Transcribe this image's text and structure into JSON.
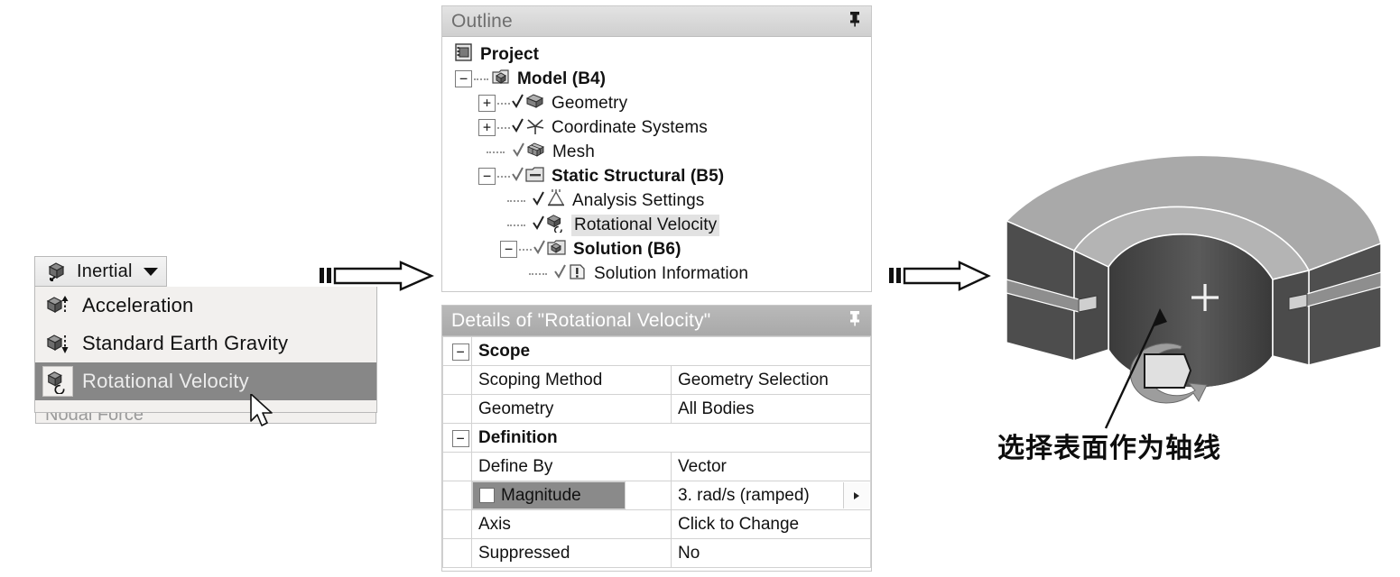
{
  "toolbar": {
    "inertial_button_label": "Inertial",
    "inertial_icon": "inertial-cube-icon",
    "caret_icon": "chevron-down-icon"
  },
  "inertial_menu": {
    "items": [
      {
        "label": "Acceleration",
        "icon": "acceleration-cube-icon",
        "selected": false
      },
      {
        "label": "Standard Earth Gravity",
        "icon": "gravity-cube-icon",
        "selected": false
      },
      {
        "label": "Rotational Velocity",
        "icon": "rotational-velocity-cube-icon",
        "selected": true
      }
    ],
    "partial_item_label": "Nodal Force"
  },
  "outline": {
    "title": "Outline",
    "pin_icon": "pin-icon",
    "tree": [
      {
        "label": "Project",
        "depth": 0,
        "bold": true,
        "expander": "",
        "icon": "project-icon",
        "highlighted": false
      },
      {
        "label": "Model (B4)",
        "depth": 1,
        "bold": true,
        "expander": "minus",
        "icon": "model-cube-icon",
        "highlighted": false
      },
      {
        "label": "Geometry",
        "depth": 2,
        "bold": false,
        "expander": "plus",
        "icon": "geometry-icon",
        "highlighted": false
      },
      {
        "label": "Coordinate Systems",
        "depth": 2,
        "bold": false,
        "expander": "plus",
        "icon": "coordinate-systems-icon",
        "highlighted": false
      },
      {
        "label": "Mesh",
        "depth": 2,
        "bold": false,
        "expander": "",
        "icon": "mesh-icon",
        "highlighted": false
      },
      {
        "label": "Static Structural (B5)",
        "depth": 2,
        "bold": true,
        "expander": "minus",
        "icon": "static-structural-icon",
        "highlighted": false
      },
      {
        "label": "Analysis Settings",
        "depth": 3,
        "bold": false,
        "expander": "",
        "icon": "analysis-settings-icon",
        "highlighted": false
      },
      {
        "label": "Rotational Velocity",
        "depth": 3,
        "bold": false,
        "expander": "",
        "icon": "rotational-velocity-cube-icon",
        "highlighted": true
      },
      {
        "label": "Solution (B6)",
        "depth": 3,
        "bold": true,
        "expander": "minus",
        "icon": "solution-icon",
        "highlighted": false
      },
      {
        "label": "Solution Information",
        "depth": 4,
        "bold": false,
        "expander": "",
        "icon": "solution-information-icon",
        "highlighted": false
      }
    ]
  },
  "details": {
    "title": "Details of \"Rotational Velocity\"",
    "pin_icon": "pin-icon",
    "rows": [
      {
        "type": "category",
        "key": "Scope",
        "value": "",
        "expander": "minus"
      },
      {
        "type": "property",
        "key": "Scoping Method",
        "value": "Geometry Selection"
      },
      {
        "type": "property",
        "key": "Geometry",
        "value": "All Bodies"
      },
      {
        "type": "category",
        "key": "Definition",
        "value": "",
        "expander": "minus"
      },
      {
        "type": "property",
        "key": "Define By",
        "value": "Vector"
      },
      {
        "type": "property-highlighted",
        "key": "Magnitude",
        "value": "3. rad/s  (ramped)",
        "has_checkbox": true,
        "has_arrow": true
      },
      {
        "type": "property",
        "key": "Axis",
        "value": "Click to Change"
      },
      {
        "type": "property",
        "key": "Suppressed",
        "value": "No"
      }
    ]
  },
  "annotation": {
    "text": "选择表面作为轴线"
  },
  "connectors": {
    "arrow_1": "block-arrow-right-icon",
    "arrow_2": "block-arrow-right-icon"
  },
  "model_viewport": {
    "crosshair": "crosshair-marker-icon",
    "rotation_glyph": "rotation-axis-glyph-icon",
    "callout_arrow": "callout-arrow-icon"
  },
  "colors": {
    "selection_gray": "#878787",
    "panel_title_gray": "#b9b9b9",
    "highlight_row": "#8a8a8a",
    "tree_highlight": "#e2e2e2",
    "model_light": "#a8a8a8",
    "model_dark": "#4a4a4a"
  }
}
